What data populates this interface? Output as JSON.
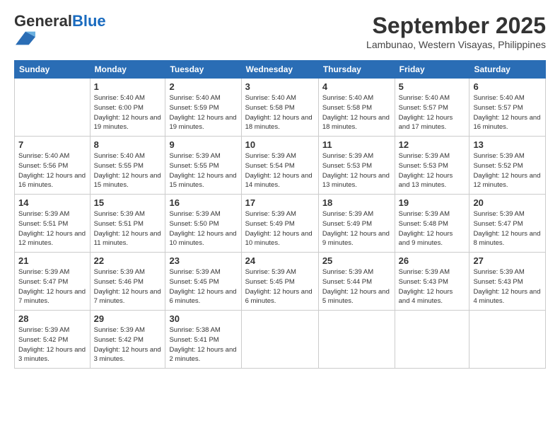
{
  "logo": {
    "general": "General",
    "blue": "Blue"
  },
  "title": "September 2025",
  "location": "Lambunao, Western Visayas, Philippines",
  "headers": [
    "Sunday",
    "Monday",
    "Tuesday",
    "Wednesday",
    "Thursday",
    "Friday",
    "Saturday"
  ],
  "weeks": [
    [
      {
        "day": "",
        "info": ""
      },
      {
        "day": "1",
        "info": "Sunrise: 5:40 AM\nSunset: 6:00 PM\nDaylight: 12 hours\nand 19 minutes."
      },
      {
        "day": "2",
        "info": "Sunrise: 5:40 AM\nSunset: 5:59 PM\nDaylight: 12 hours\nand 19 minutes."
      },
      {
        "day": "3",
        "info": "Sunrise: 5:40 AM\nSunset: 5:58 PM\nDaylight: 12 hours\nand 18 minutes."
      },
      {
        "day": "4",
        "info": "Sunrise: 5:40 AM\nSunset: 5:58 PM\nDaylight: 12 hours\nand 18 minutes."
      },
      {
        "day": "5",
        "info": "Sunrise: 5:40 AM\nSunset: 5:57 PM\nDaylight: 12 hours\nand 17 minutes."
      },
      {
        "day": "6",
        "info": "Sunrise: 5:40 AM\nSunset: 5:57 PM\nDaylight: 12 hours\nand 16 minutes."
      }
    ],
    [
      {
        "day": "7",
        "info": "Sunrise: 5:40 AM\nSunset: 5:56 PM\nDaylight: 12 hours\nand 16 minutes."
      },
      {
        "day": "8",
        "info": "Sunrise: 5:40 AM\nSunset: 5:55 PM\nDaylight: 12 hours\nand 15 minutes."
      },
      {
        "day": "9",
        "info": "Sunrise: 5:39 AM\nSunset: 5:55 PM\nDaylight: 12 hours\nand 15 minutes."
      },
      {
        "day": "10",
        "info": "Sunrise: 5:39 AM\nSunset: 5:54 PM\nDaylight: 12 hours\nand 14 minutes."
      },
      {
        "day": "11",
        "info": "Sunrise: 5:39 AM\nSunset: 5:53 PM\nDaylight: 12 hours\nand 13 minutes."
      },
      {
        "day": "12",
        "info": "Sunrise: 5:39 AM\nSunset: 5:53 PM\nDaylight: 12 hours\nand 13 minutes."
      },
      {
        "day": "13",
        "info": "Sunrise: 5:39 AM\nSunset: 5:52 PM\nDaylight: 12 hours\nand 12 minutes."
      }
    ],
    [
      {
        "day": "14",
        "info": "Sunrise: 5:39 AM\nSunset: 5:51 PM\nDaylight: 12 hours\nand 12 minutes."
      },
      {
        "day": "15",
        "info": "Sunrise: 5:39 AM\nSunset: 5:51 PM\nDaylight: 12 hours\nand 11 minutes."
      },
      {
        "day": "16",
        "info": "Sunrise: 5:39 AM\nSunset: 5:50 PM\nDaylight: 12 hours\nand 10 minutes."
      },
      {
        "day": "17",
        "info": "Sunrise: 5:39 AM\nSunset: 5:49 PM\nDaylight: 12 hours\nand 10 minutes."
      },
      {
        "day": "18",
        "info": "Sunrise: 5:39 AM\nSunset: 5:49 PM\nDaylight: 12 hours\nand 9 minutes."
      },
      {
        "day": "19",
        "info": "Sunrise: 5:39 AM\nSunset: 5:48 PM\nDaylight: 12 hours\nand 9 minutes."
      },
      {
        "day": "20",
        "info": "Sunrise: 5:39 AM\nSunset: 5:47 PM\nDaylight: 12 hours\nand 8 minutes."
      }
    ],
    [
      {
        "day": "21",
        "info": "Sunrise: 5:39 AM\nSunset: 5:47 PM\nDaylight: 12 hours\nand 7 minutes."
      },
      {
        "day": "22",
        "info": "Sunrise: 5:39 AM\nSunset: 5:46 PM\nDaylight: 12 hours\nand 7 minutes."
      },
      {
        "day": "23",
        "info": "Sunrise: 5:39 AM\nSunset: 5:45 PM\nDaylight: 12 hours\nand 6 minutes."
      },
      {
        "day": "24",
        "info": "Sunrise: 5:39 AM\nSunset: 5:45 PM\nDaylight: 12 hours\nand 6 minutes."
      },
      {
        "day": "25",
        "info": "Sunrise: 5:39 AM\nSunset: 5:44 PM\nDaylight: 12 hours\nand 5 minutes."
      },
      {
        "day": "26",
        "info": "Sunrise: 5:39 AM\nSunset: 5:43 PM\nDaylight: 12 hours\nand 4 minutes."
      },
      {
        "day": "27",
        "info": "Sunrise: 5:39 AM\nSunset: 5:43 PM\nDaylight: 12 hours\nand 4 minutes."
      }
    ],
    [
      {
        "day": "28",
        "info": "Sunrise: 5:39 AM\nSunset: 5:42 PM\nDaylight: 12 hours\nand 3 minutes."
      },
      {
        "day": "29",
        "info": "Sunrise: 5:39 AM\nSunset: 5:42 PM\nDaylight: 12 hours\nand 3 minutes."
      },
      {
        "day": "30",
        "info": "Sunrise: 5:38 AM\nSunset: 5:41 PM\nDaylight: 12 hours\nand 2 minutes."
      },
      {
        "day": "",
        "info": ""
      },
      {
        "day": "",
        "info": ""
      },
      {
        "day": "",
        "info": ""
      },
      {
        "day": "",
        "info": ""
      }
    ]
  ]
}
